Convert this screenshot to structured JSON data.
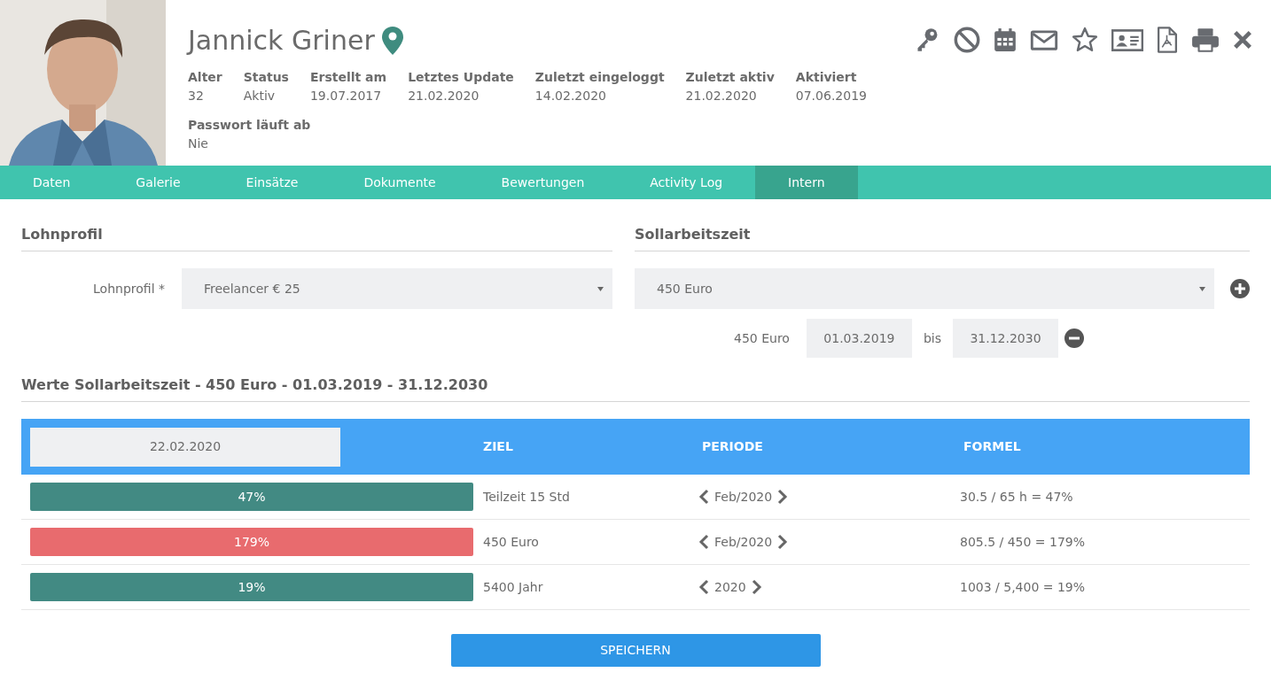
{
  "profile": {
    "name": "Jannick Griner",
    "facts": [
      {
        "label": "Alter",
        "value": "32"
      },
      {
        "label": "Status",
        "value": "Aktiv"
      },
      {
        "label": "Erstellt am",
        "value": "19.07.2017"
      },
      {
        "label": "Letztes Update",
        "value": "21.02.2020"
      },
      {
        "label": "Zuletzt eingeloggt",
        "value": "14.02.2020"
      },
      {
        "label": "Zuletzt aktiv",
        "value": "21.02.2020"
      },
      {
        "label": "Aktiviert",
        "value": "07.06.2019"
      }
    ],
    "password": {
      "label": "Passwort läuft ab",
      "value": "Nie"
    }
  },
  "toolbar": [
    {
      "kind": "key"
    },
    {
      "kind": "block"
    },
    {
      "kind": "calendar"
    },
    {
      "kind": "mail"
    },
    {
      "kind": "star"
    },
    {
      "kind": "card"
    },
    {
      "kind": "pdf"
    },
    {
      "kind": "print"
    },
    {
      "kind": "close"
    }
  ],
  "tabs": [
    {
      "label": "Daten",
      "selected": false
    },
    {
      "label": "Galerie",
      "selected": false
    },
    {
      "label": "Einsätze",
      "selected": false
    },
    {
      "label": "Dokumente",
      "selected": false
    },
    {
      "label": "Bewertungen",
      "selected": false
    },
    {
      "label": "Activity Log",
      "selected": false
    },
    {
      "label": "Intern",
      "selected": true
    }
  ],
  "lohnprofil": {
    "heading": "Lohnprofil",
    "label": "Lohnprofil *",
    "value": "Freelancer € 25"
  },
  "sollarbeitszeit": {
    "heading": "Sollarbeitszeit",
    "value": "450 Euro",
    "range": {
      "label": "450 Euro",
      "from": "01.03.2019",
      "separator": "bis",
      "to": "31.12.2030"
    }
  },
  "werte": {
    "heading": "Werte Sollarbeitszeit - 450 Euro - 01.03.2019 - 31.12.2030",
    "date": "22.02.2020",
    "columns": [
      "ZIEL",
      "PERIODE",
      "FORMEL"
    ],
    "rows": [
      {
        "percent": "47%",
        "color": "#428a83",
        "ziel": "Teilzeit 15 Std",
        "periode": "Feb/2020",
        "formel": "30.5 / 65 h = 47%"
      },
      {
        "percent": "179%",
        "color": "#e86b6e",
        "ziel": "450 Euro",
        "periode": "Feb/2020",
        "formel": "805.5 / 450 = 179%"
      },
      {
        "percent": "19%",
        "color": "#428a83",
        "ziel": "5400 Jahr",
        "periode": "2020",
        "formel": "1003 / 5,400 = 19%"
      }
    ]
  },
  "save_button": "SPEICHERN"
}
